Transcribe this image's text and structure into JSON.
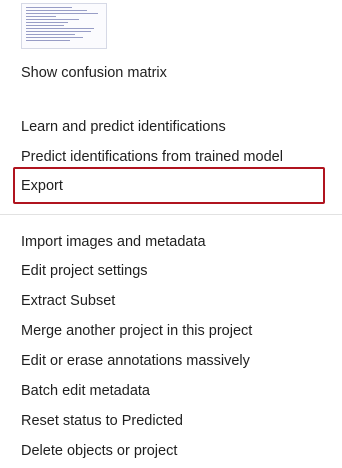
{
  "menu": {
    "top_items": [
      {
        "label": "Show confusion matrix"
      }
    ],
    "learning_items": [
      {
        "label": "Learn and predict identifications"
      },
      {
        "label": "Predict identifications from trained model"
      },
      {
        "label": "Export",
        "highlighted": true
      }
    ],
    "project_items": [
      {
        "label": "Import images and metadata"
      },
      {
        "label": "Edit project settings"
      },
      {
        "label": "Extract Subset"
      },
      {
        "label": "Merge another project in this project"
      },
      {
        "label": "Edit or erase annotations massively"
      },
      {
        "label": "Batch edit metadata"
      },
      {
        "label": "Reset status to Predicted"
      },
      {
        "label": "Delete objects or project"
      }
    ]
  },
  "colors": {
    "highlight_border": "#b0141f",
    "text": "#1f1f1f",
    "divider": "#e2e2e2"
  }
}
